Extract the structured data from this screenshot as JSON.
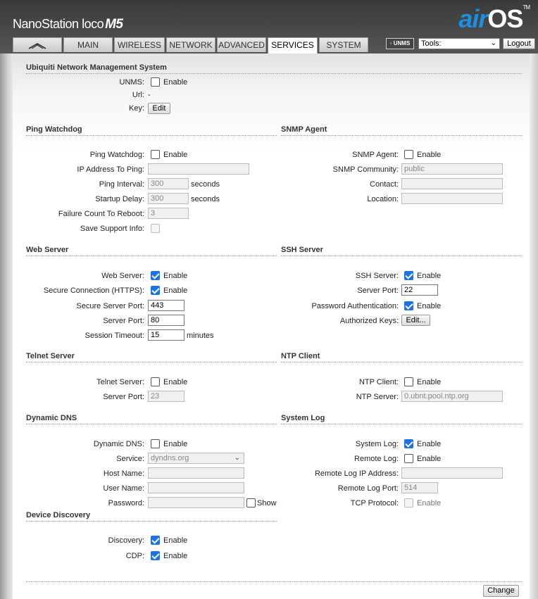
{
  "brand": {
    "name": "NanoStation loco",
    "model": "M5"
  },
  "logo": {
    "air": "air",
    "os": "OS",
    "tm": "TM"
  },
  "tabs": [
    {
      "label": "MAIN"
    },
    {
      "label": "WIRELESS"
    },
    {
      "label": "NETWORK"
    },
    {
      "label": "ADVANCED"
    },
    {
      "label": "SERVICES"
    },
    {
      "label": "SYSTEM"
    }
  ],
  "toolbar": {
    "unms_badge": "UNMS",
    "tools_value": "Tools:",
    "logout": "Logout"
  },
  "unms": {
    "title": "Ubiquiti Network Management System",
    "unms_label": "UNMS:",
    "enable": "Enable",
    "url_label": "Url:",
    "url_value": "-",
    "key_label": "Key:",
    "key_button": "Edit"
  },
  "ping": {
    "title": "Ping Watchdog",
    "watchdog_label": "Ping Watchdog:",
    "enable": "Enable",
    "ip_label": "IP Address To Ping:",
    "ip_value": "",
    "interval_label": "Ping Interval:",
    "interval_value": "300",
    "interval_unit": "seconds",
    "delay_label": "Startup Delay:",
    "delay_value": "300",
    "delay_unit": "seconds",
    "failure_label": "Failure Count To Reboot:",
    "failure_value": "3",
    "support_label": "Save Support Info:"
  },
  "snmp": {
    "title": "SNMP Agent",
    "agent_label": "SNMP Agent:",
    "enable": "Enable",
    "community_label": "SNMP Community:",
    "community_value": "public",
    "contact_label": "Contact:",
    "contact_value": "",
    "location_label": "Location:",
    "location_value": ""
  },
  "web": {
    "title": "Web Server",
    "server_label": "Web Server:",
    "enable": "Enable",
    "https_label": "Secure Connection (HTTPS):",
    "https_enable": "Enable",
    "secure_port_label": "Secure Server Port:",
    "secure_port_value": "443",
    "port_label": "Server Port:",
    "port_value": "80",
    "timeout_label": "Session Timeout:",
    "timeout_value": "15",
    "timeout_unit": "minutes"
  },
  "ssh": {
    "title": "SSH Server",
    "server_label": "SSH Server:",
    "enable": "Enable",
    "port_label": "Server Port:",
    "port_value": "22",
    "password_label": "Password Authentication:",
    "password_enable": "Enable",
    "keys_label": "Authorized Keys:",
    "keys_button": "Edit..."
  },
  "telnet": {
    "title": "Telnet Server",
    "server_label": "Telnet Server:",
    "enable": "Enable",
    "port_label": "Server Port:",
    "port_value": "23"
  },
  "ntp": {
    "title": "NTP Client",
    "client_label": "NTP Client:",
    "enable": "Enable",
    "server_label": "NTP Server:",
    "server_value": "0.ubnt.pool.ntp.org"
  },
  "ddns": {
    "title": "Dynamic DNS",
    "ddns_label": "Dynamic DNS:",
    "enable": "Enable",
    "service_label": "Service:",
    "service_value": "dyndns.org",
    "host_label": "Host Name:",
    "host_value": "",
    "user_label": "User Name:",
    "user_value": "",
    "password_label": "Password:",
    "password_value": "",
    "show_label": "Show"
  },
  "syslog": {
    "title": "System Log",
    "system_label": "System Log:",
    "system_enable": "Enable",
    "remote_label": "Remote Log:",
    "remote_enable": "Enable",
    "remote_ip_label": "Remote Log IP Address:",
    "remote_ip_value": "",
    "remote_port_label": "Remote Log Port:",
    "remote_port_value": "514",
    "tcp_label": "TCP Protocol:",
    "tcp_enable": "Enable"
  },
  "discovery": {
    "title": "Device Discovery",
    "discovery_label": "Discovery:",
    "discovery_enable": "Enable",
    "cdp_label": "CDP:",
    "cdp_enable": "Enable"
  },
  "footer": {
    "change_button": "Change"
  }
}
